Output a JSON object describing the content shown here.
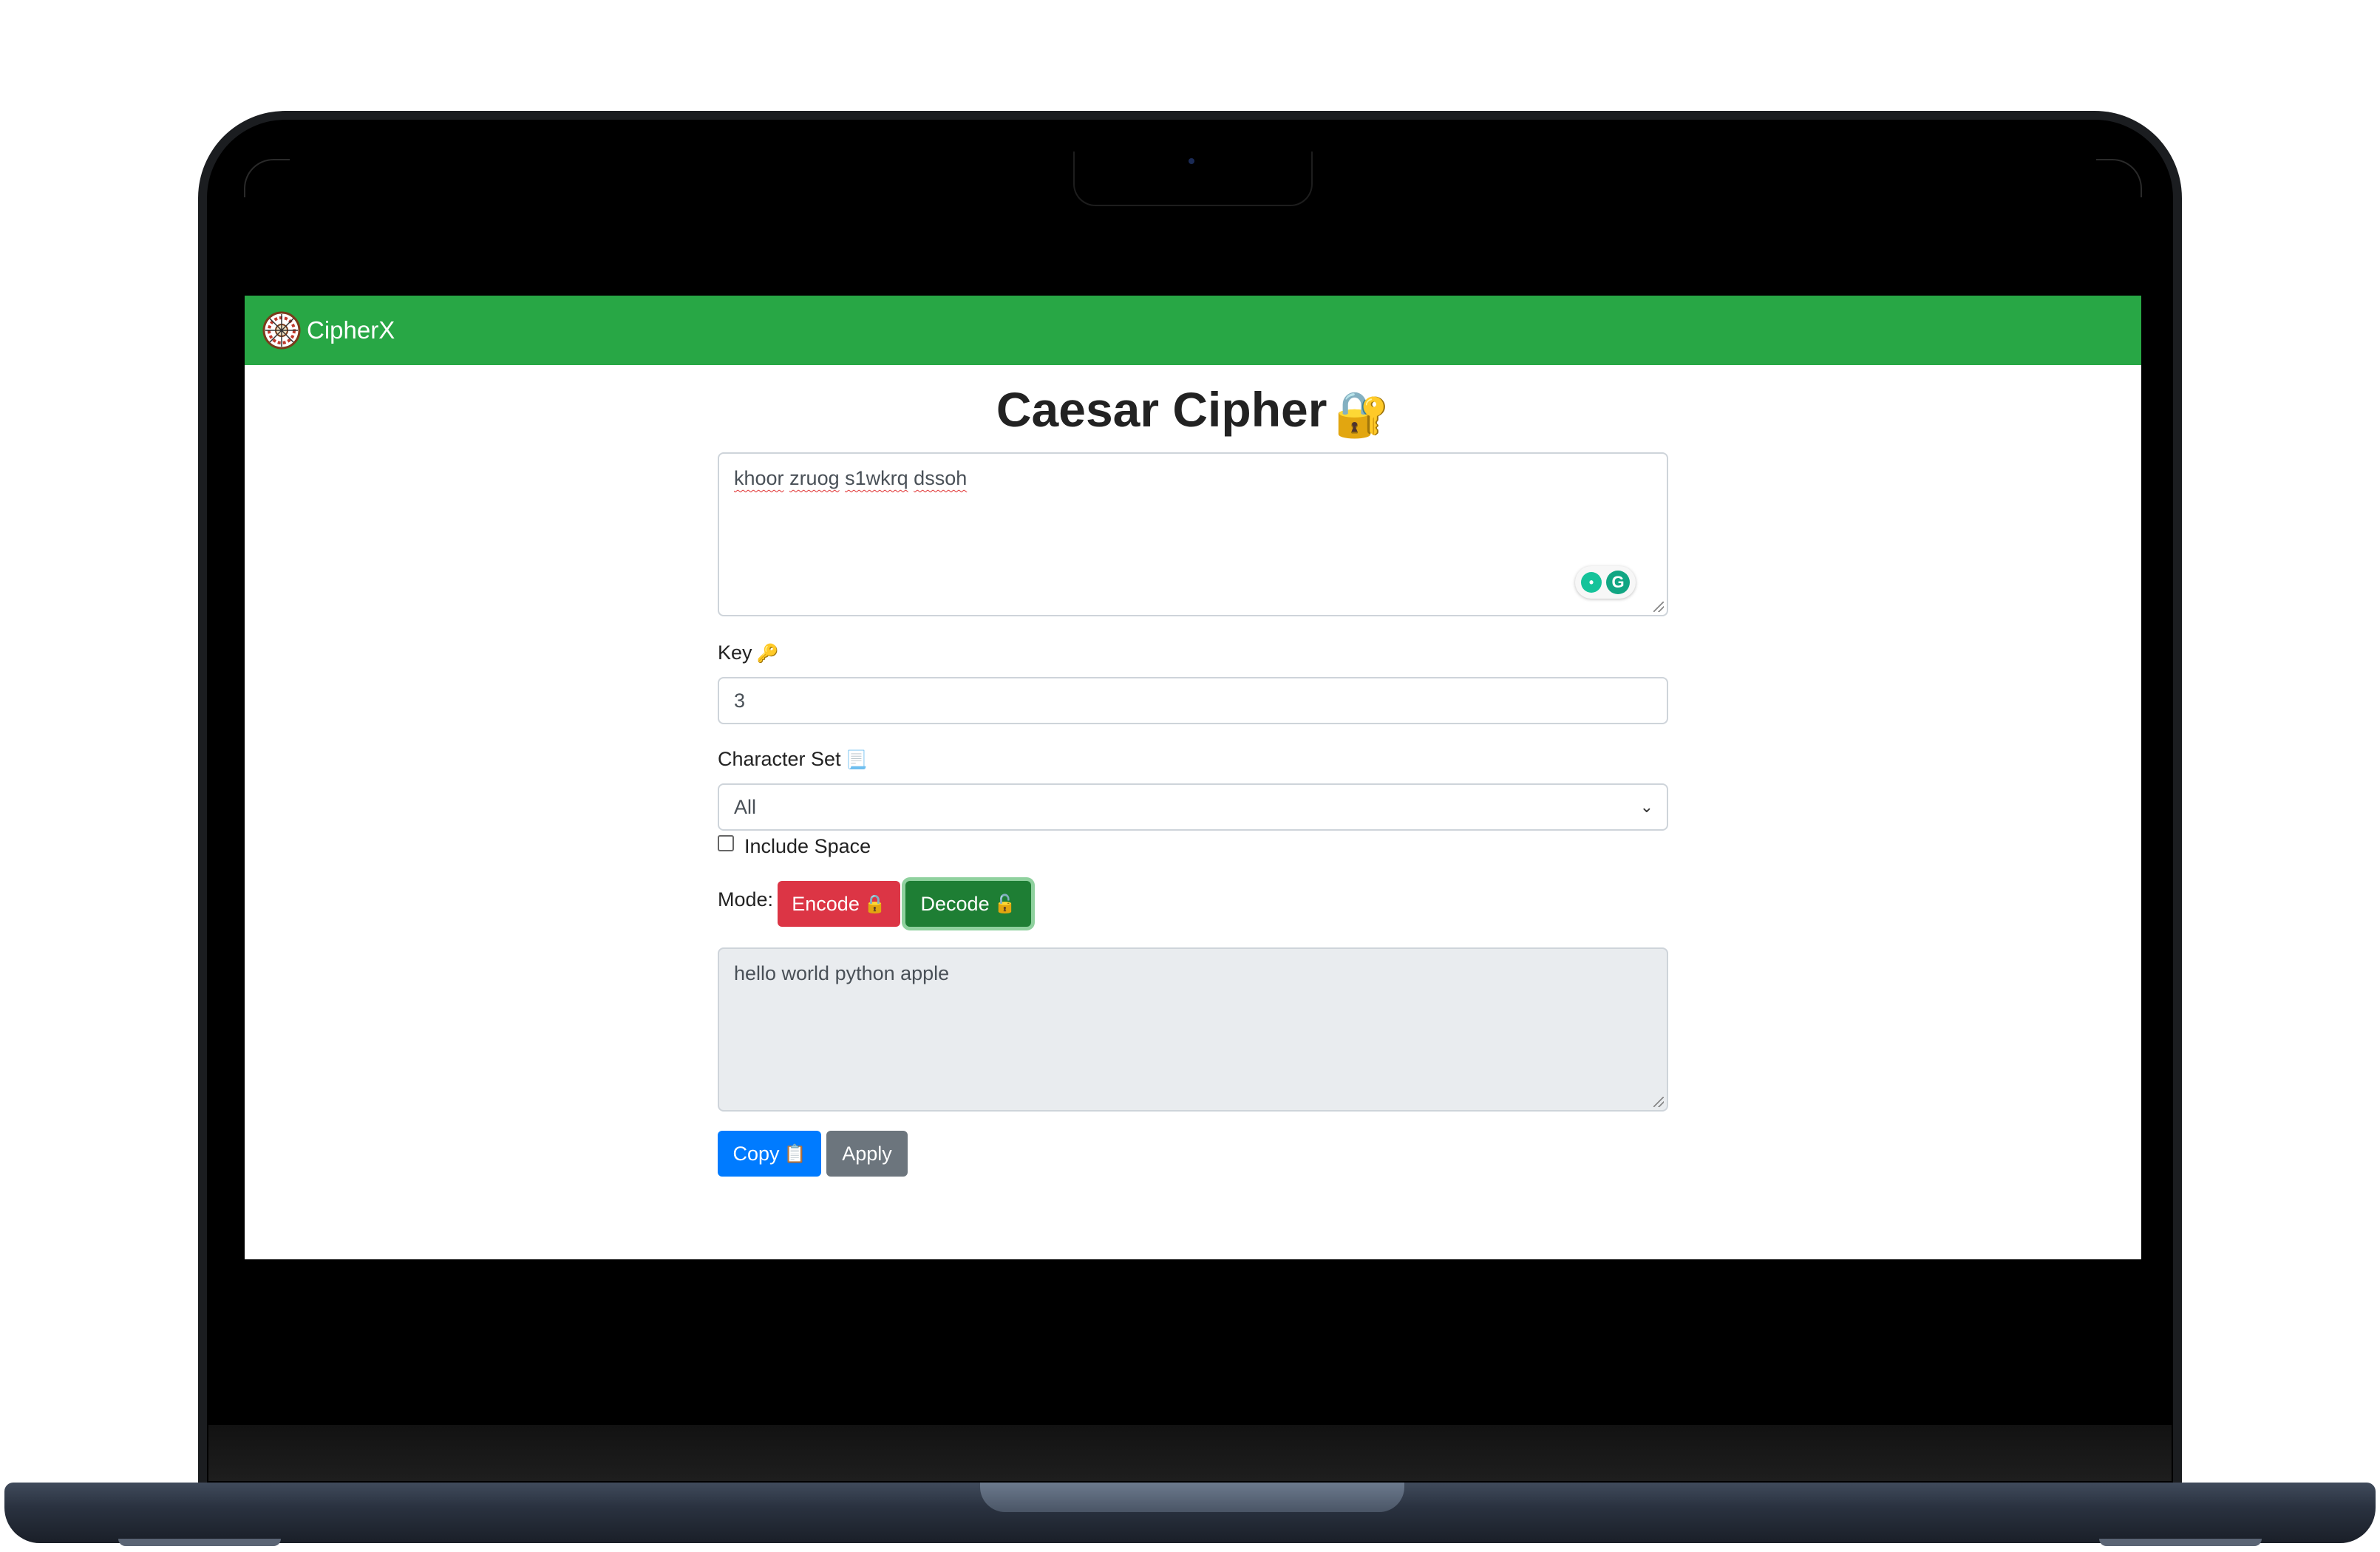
{
  "app": {
    "brand_name": "CipherX",
    "brand_color": "#28a745"
  },
  "page": {
    "title": "Caesar Cipher",
    "title_icon": "🔐"
  },
  "input": {
    "value_words": [
      "khoor",
      "zruog",
      "s1wkrq",
      "dssoh"
    ]
  },
  "key": {
    "label": "Key",
    "label_icon": "🔑",
    "value": "3"
  },
  "charset": {
    "label": "Character Set",
    "label_icon": "📃",
    "selected": "All",
    "arrow": "⌄"
  },
  "include_space": {
    "label": "Include Space",
    "checked": false
  },
  "mode": {
    "label": "Mode:",
    "encode_label": "Encode",
    "encode_icon": "🔒",
    "decode_label": "Decode",
    "decode_icon": "🔓",
    "active": "decode"
  },
  "output": {
    "value": "hello world python apple"
  },
  "actions": {
    "copy_label": "Copy",
    "copy_icon": "📋",
    "apply_label": "Apply"
  },
  "colors": {
    "encode": "#dc3545",
    "decode": "#1e7e34",
    "copy": "#007bff",
    "apply": "#6c757d"
  }
}
